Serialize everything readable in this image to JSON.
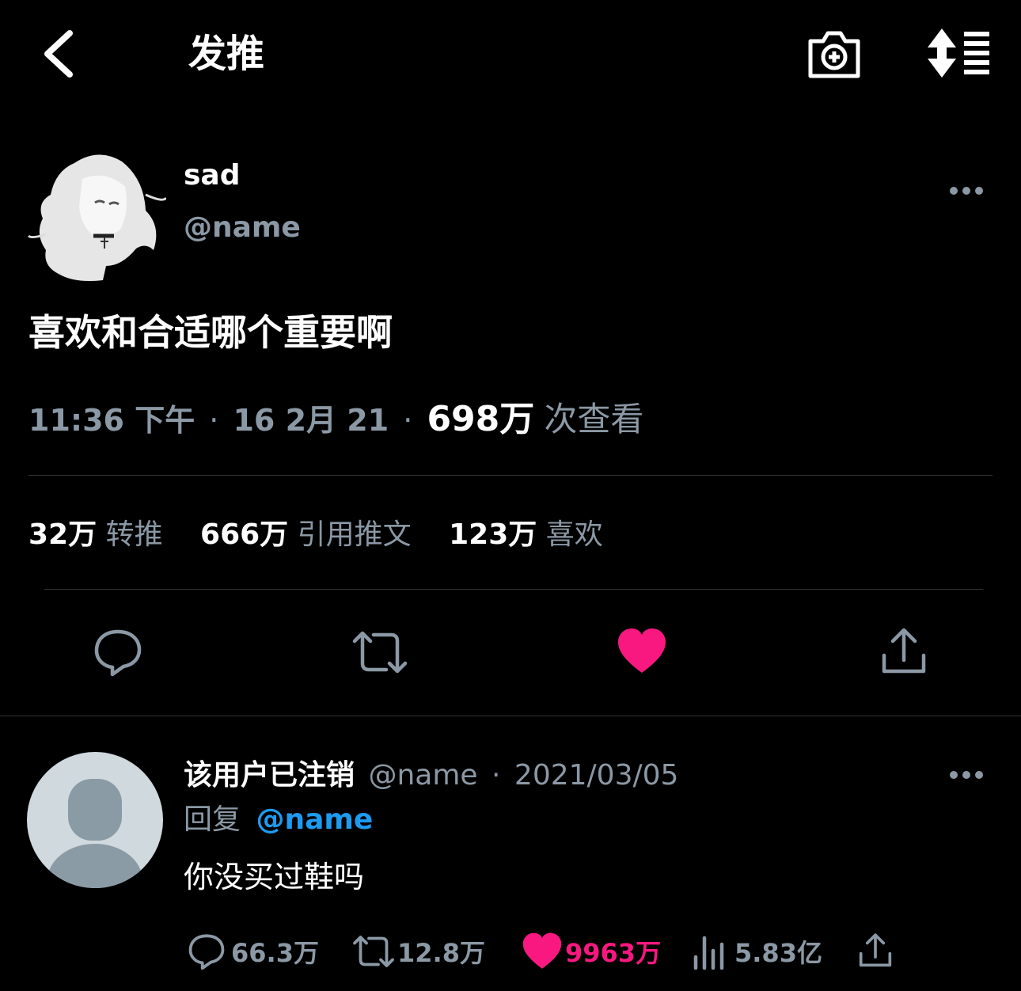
{
  "header": {
    "title": "发推"
  },
  "tweet": {
    "display_name": "sad",
    "handle": "@name",
    "text": "喜欢和合适哪个重要啊",
    "time": "11:36 下午",
    "sep1": "·",
    "date": "16 2月 21",
    "sep2": "·",
    "views_count": "698万",
    "views_label": "次查看",
    "stats": {
      "retweets_count": "32万",
      "retweets_label": "转推",
      "quotes_count": "666万",
      "quotes_label": "引用推文",
      "likes_count": "123万",
      "likes_label": "喜欢"
    },
    "liked": true
  },
  "reply": {
    "display_name": "该用户已注销",
    "handle": "@name",
    "sep": "·",
    "date": "2021/03/05",
    "reply_prefix": "回复",
    "reply_to": "@name",
    "text": "你没买过鞋吗",
    "replies": "66.3万",
    "retweets": "12.8万",
    "likes": "9963万",
    "views": "5.83亿"
  },
  "colors": {
    "like": "#f91880",
    "link": "#1d9bf0",
    "muted": "#8b98a5",
    "bg": "#000000"
  },
  "icons": [
    "back-icon",
    "camera-plus-icon",
    "sort-list-icon",
    "more-icon",
    "reply-icon",
    "retweet-icon",
    "heart-icon",
    "share-icon",
    "views-icon"
  ]
}
